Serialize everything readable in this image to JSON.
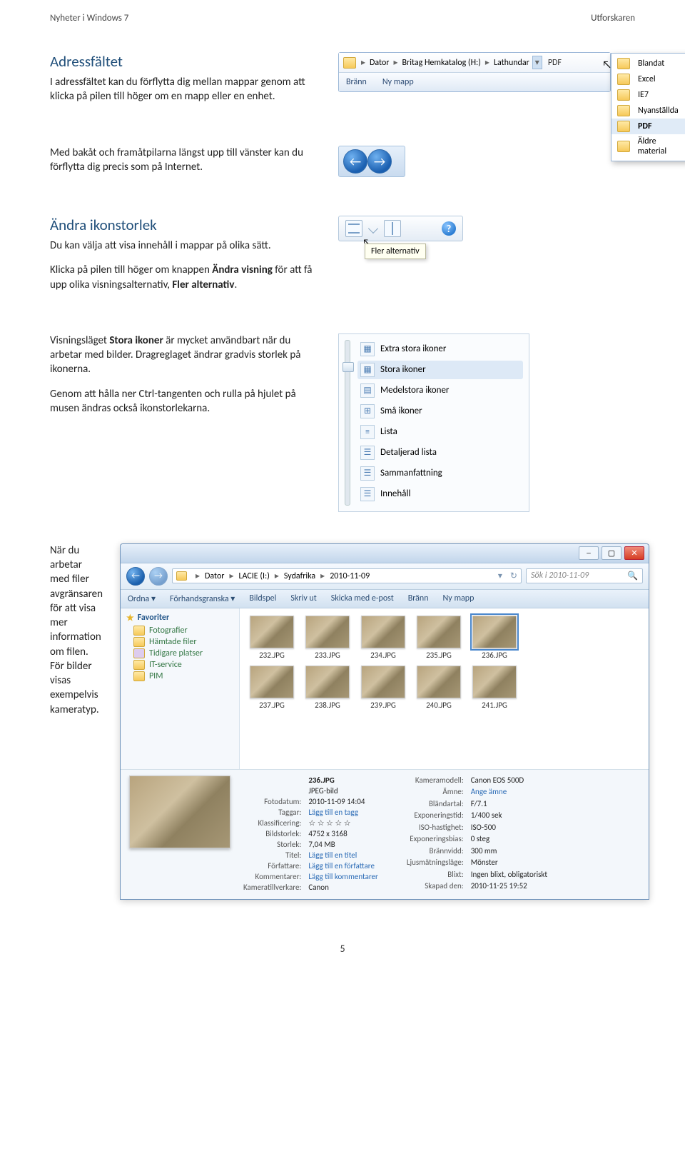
{
  "header": {
    "left": "Nyheter i Windows 7",
    "right": "Utforskaren"
  },
  "s1": {
    "title": "Adressfältet",
    "body": "I adressfältet kan du förflytta dig mellan mappar genom att klicka på pilen till höger om en mapp eller en enhet.",
    "crumbs": [
      "Dator",
      "Britag Hemkatalog (H:)",
      "Lathundar",
      "PDF"
    ],
    "dropdown": [
      "Blandat",
      "Excel",
      "IE7",
      "Nyanställda",
      "PDF",
      "Äldre material"
    ],
    "toolbar": [
      "Bränn",
      "Ny mapp"
    ]
  },
  "s2": {
    "body": "Med bakåt och framåtpilarna längst upp till vänster kan du förflytta dig precis som på Internet."
  },
  "s3": {
    "title": "Ändra ikonstorlek",
    "p1": "Du kan välja att visa innehåll i mappar på olika sätt.",
    "p2a": "Klicka på pilen till höger om knappen ",
    "p2bold": "Ändra visning",
    "p2b": " för att få upp olika visningsalternativ, ",
    "p2bold2": "Fler alternativ",
    "p2c": ".",
    "tooltip": "Fler alternativ"
  },
  "s4": {
    "p1a": "Visningsläget ",
    "p1bold": "Stora ikoner",
    "p1b": " är mycket användbart när du arbetar med bilder. Dragreglaget ändrar gradvis storlek på ikonerna.",
    "p2": "Genom att hålla ner Ctrl-tangenten och rulla på hjulet på musen ändras också ikonstorlekarna.",
    "views": [
      "Extra stora ikoner",
      "Stora ikoner",
      "Medelstora ikoner",
      "Små ikoner",
      "Lista",
      "Detaljerad lista",
      "Sammanfattning",
      "Innehåll"
    ]
  },
  "s5": {
    "body": "När du arbetar med filer avgränsaren för att visa mer information om filen. För bilder visas exempelvis kameratyp.",
    "path": [
      "Dator",
      "LACIE (I:)",
      "Sydafrika",
      "2010-11-09"
    ],
    "search_ph": "Sök i 2010-11-09",
    "tools": [
      "Ordna ▾",
      "Förhandsgranska ▾",
      "Bildspel",
      "Skriv ut",
      "Skicka med e-post",
      "Bränn",
      "Ny mapp"
    ],
    "fav_head": "Favoriter",
    "favs": [
      "Fotografier",
      "Hämtade filer",
      "Tidigare platser",
      "IT-service",
      "PIM"
    ],
    "thumbs_row1": [
      "232.JPG",
      "233.JPG",
      "234.JPG",
      "235.JPG",
      "236.JPG"
    ],
    "thumbs_row2": [
      "237.JPG",
      "238.JPG",
      "239.JPG",
      "240.JPG",
      "241.JPG"
    ],
    "selected": "236.JPG",
    "meta_left": [
      [
        "",
        "236.JPG"
      ],
      [
        "",
        "JPEG-bild"
      ],
      [
        "Fotodatum:",
        "2010-11-09 14:04"
      ],
      [
        "Taggar:",
        "Lägg till en tagg"
      ],
      [
        "Klassificering:",
        "☆ ☆ ☆ ☆ ☆"
      ],
      [
        "Bildstorlek:",
        "4752 x 3168"
      ],
      [
        "Storlek:",
        "7,04 MB"
      ],
      [
        "Titel:",
        "Lägg till en titel"
      ],
      [
        "Författare:",
        "Lägg till en författare"
      ],
      [
        "Kommentarer:",
        "Lägg till kommentarer"
      ],
      [
        "Kameratillverkare:",
        "Canon"
      ]
    ],
    "meta_right": [
      [
        "Kameramodell:",
        "Canon EOS 500D"
      ],
      [
        "Ämne:",
        "Ange ämne"
      ],
      [
        "Bländartal:",
        "F/7.1"
      ],
      [
        "Exponeringstid:",
        "1/400 sek"
      ],
      [
        "ISO-hastighet:",
        "ISO-500"
      ],
      [
        "Exponeringsbias:",
        "0 steg"
      ],
      [
        "Brännvidd:",
        "300 mm"
      ],
      [
        "Ljusmätningsläge:",
        "Mönster"
      ],
      [
        "Blixt:",
        "Ingen blixt, obligatoriskt"
      ],
      [
        "Skapad den:",
        "2010-11-25 19:52"
      ]
    ]
  },
  "pagenum": "5"
}
